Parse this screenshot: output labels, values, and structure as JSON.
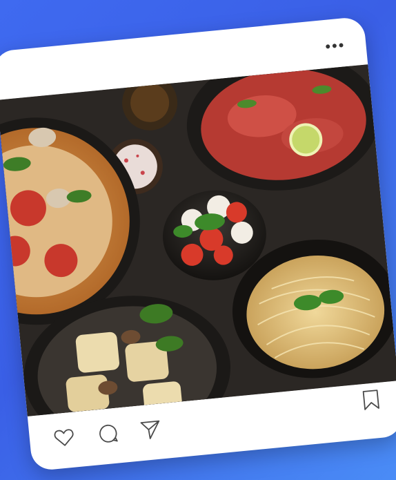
{
  "post": {
    "menu_glyph": "•••",
    "image": {
      "subject": "italian-dishes-flatlay"
    },
    "actions": {
      "like_icon": "heart-icon",
      "comment_icon": "comment-icon",
      "share_icon": "send-icon",
      "save_icon": "bookmark-icon"
    }
  },
  "colors": {
    "background": "#3f6af0",
    "card": "#ffffff",
    "icon_stroke": "#4a4a4a"
  }
}
